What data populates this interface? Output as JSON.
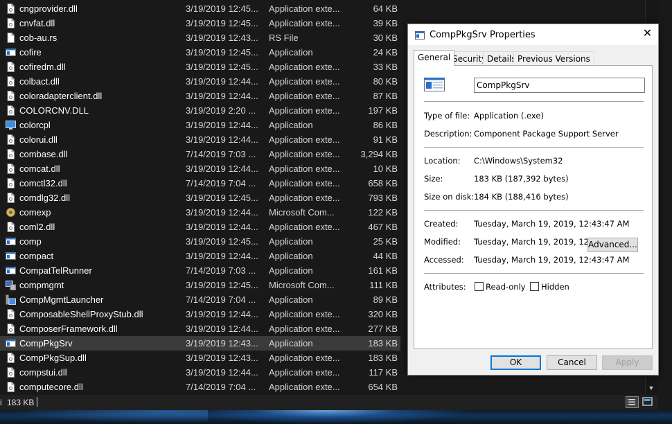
{
  "files": [
    {
      "name": "cngprovider.dll",
      "date": "3/19/2019 12:45...",
      "type": "Application exte...",
      "size": "64 KB",
      "icon": "dll-icon"
    },
    {
      "name": "cnvfat.dll",
      "date": "3/19/2019 12:45...",
      "type": "Application exte...",
      "size": "39 KB",
      "icon": "dll-icon"
    },
    {
      "name": "cob-au.rs",
      "date": "3/19/2019 12:43...",
      "type": "RS File",
      "size": "30 KB",
      "icon": "file-icon"
    },
    {
      "name": "cofire",
      "date": "3/19/2019 12:45...",
      "type": "Application",
      "size": "24 KB",
      "icon": "exe-icon"
    },
    {
      "name": "cofiredm.dll",
      "date": "3/19/2019 12:45...",
      "type": "Application exte...",
      "size": "33 KB",
      "icon": "dll-icon"
    },
    {
      "name": "colbact.dll",
      "date": "3/19/2019 12:44...",
      "type": "Application exte...",
      "size": "80 KB",
      "icon": "dll-icon"
    },
    {
      "name": "coloradapterclient.dll",
      "date": "3/19/2019 12:44...",
      "type": "Application exte...",
      "size": "87 KB",
      "icon": "dll-icon"
    },
    {
      "name": "COLORCNV.DLL",
      "date": "3/19/2019 2:20 ...",
      "type": "Application exte...",
      "size": "197 KB",
      "icon": "dll-icon"
    },
    {
      "name": "colorcpl",
      "date": "3/19/2019 12:44...",
      "type": "Application",
      "size": "86 KB",
      "icon": "monitor-icon"
    },
    {
      "name": "colorui.dll",
      "date": "3/19/2019 12:44...",
      "type": "Application exte...",
      "size": "91 KB",
      "icon": "dll-icon"
    },
    {
      "name": "combase.dll",
      "date": "7/14/2019 7:03 ...",
      "type": "Application exte...",
      "size": "3,294 KB",
      "icon": "dll-icon"
    },
    {
      "name": "comcat.dll",
      "date": "3/19/2019 12:44...",
      "type": "Application exte...",
      "size": "10 KB",
      "icon": "dll-icon"
    },
    {
      "name": "comctl32.dll",
      "date": "7/14/2019 7:04 ...",
      "type": "Application exte...",
      "size": "658 KB",
      "icon": "dll-icon"
    },
    {
      "name": "comdlg32.dll",
      "date": "3/19/2019 12:45...",
      "type": "Application exte...",
      "size": "793 KB",
      "icon": "dll-icon"
    },
    {
      "name": "comexp",
      "date": "3/19/2019 12:44...",
      "type": "Microsoft Com...",
      "size": "122 KB",
      "icon": "gear-icon"
    },
    {
      "name": "coml2.dll",
      "date": "3/19/2019 12:44...",
      "type": "Application exte...",
      "size": "467 KB",
      "icon": "dll-icon"
    },
    {
      "name": "comp",
      "date": "3/19/2019 12:45...",
      "type": "Application",
      "size": "25 KB",
      "icon": "exe-icon"
    },
    {
      "name": "compact",
      "date": "3/19/2019 12:44...",
      "type": "Application",
      "size": "44 KB",
      "icon": "exe-icon"
    },
    {
      "name": "CompatTelRunner",
      "date": "7/14/2019 7:03 ...",
      "type": "Application",
      "size": "161 KB",
      "icon": "exe-icon"
    },
    {
      "name": "compmgmt",
      "date": "3/19/2019 12:45...",
      "type": "Microsoft Com...",
      "size": "111 KB",
      "icon": "computer-management-icon"
    },
    {
      "name": "CompMgmtLauncher",
      "date": "7/14/2019 7:04 ...",
      "type": "Application",
      "size": "89 KB",
      "icon": "launcher-icon"
    },
    {
      "name": "ComposableShellProxyStub.dll",
      "date": "3/19/2019 12:44...",
      "type": "Application exte...",
      "size": "320 KB",
      "icon": "dll-icon"
    },
    {
      "name": "ComposerFramework.dll",
      "date": "3/19/2019 12:44...",
      "type": "Application exte...",
      "size": "277 KB",
      "icon": "dll-icon"
    },
    {
      "name": "CompPkgSrv",
      "date": "3/19/2019 12:43...",
      "type": "Application",
      "size": "183 KB",
      "icon": "exe-icon",
      "selected": true
    },
    {
      "name": "CompPkgSup.dll",
      "date": "3/19/2019 12:43...",
      "type": "Application exte...",
      "size": "183 KB",
      "icon": "dll-icon"
    },
    {
      "name": "compstui.dll",
      "date": "3/19/2019 12:44...",
      "type": "Application exte...",
      "size": "117 KB",
      "icon": "dll-icon"
    },
    {
      "name": "computecore.dll",
      "date": "7/14/2019 7:04 ...",
      "type": "Application exte...",
      "size": "654 KB",
      "icon": "dll-icon"
    }
  ],
  "statusbar": {
    "left_text": "i",
    "selected_size": "183 KB"
  },
  "dialog": {
    "title": "CompPkgSrv Properties",
    "tabs": [
      "General",
      "Security",
      "Details",
      "Previous Versions"
    ],
    "active_tab": "General",
    "file_name": "CompPkgSrv",
    "props": {
      "type_label": "Type of file:",
      "type_value": "Application (.exe)",
      "desc_label": "Description:",
      "desc_value": "Component Package Support Server",
      "location_label": "Location:",
      "location_value": "C:\\Windows\\System32",
      "size_label": "Size:",
      "size_value": "183 KB (187,392 bytes)",
      "size_disk_label": "Size on disk:",
      "size_disk_value": "184 KB (188,416 bytes)",
      "created_label": "Created:",
      "created_value": "Tuesday, March 19, 2019, 12:43:47 AM",
      "modified_label": "Modified:",
      "modified_value": "Tuesday, March 19, 2019, 12:43:47 AM",
      "accessed_label": "Accessed:",
      "accessed_value": "Tuesday, March 19, 2019, 12:43:47 AM",
      "attributes_label": "Attributes:"
    },
    "readonly_label": "Read-only",
    "readonly_checked": false,
    "hidden_label": "Hidden",
    "hidden_checked": false,
    "advanced_label": "Advanced...",
    "ok_label": "OK",
    "cancel_label": "Cancel",
    "apply_label": "Apply",
    "apply_enabled": false
  },
  "colors": {
    "explorer_bg": "#191919",
    "selected_row": "#3a3a3a",
    "dialog_bg": "#f0f0f0",
    "accent": "#0078d7"
  }
}
